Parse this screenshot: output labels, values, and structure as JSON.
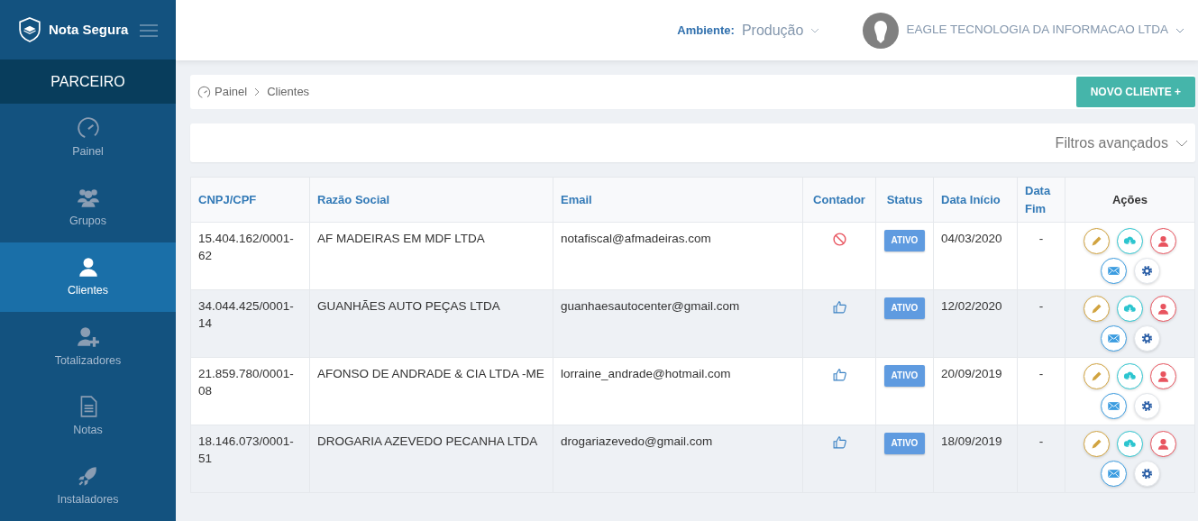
{
  "brand": "Nota Segura",
  "sidebar": {
    "section": "PARCEIRO",
    "items": [
      {
        "label": "Painel",
        "selected": false
      },
      {
        "label": "Grupos",
        "selected": false
      },
      {
        "label": "Clientes",
        "selected": true
      },
      {
        "label": "Totalizadores",
        "selected": false
      },
      {
        "label": "Notas",
        "selected": false
      },
      {
        "label": "Instaladores",
        "selected": false
      }
    ]
  },
  "topbar": {
    "env_label": "Ambiente:",
    "env_value": "Produção",
    "company": "EAGLE TECNOLOGIA DA INFORMACAO LTDA"
  },
  "breadcrumb": [
    "Painel",
    "Clientes"
  ],
  "new_button": "NOVO CLIENTE +",
  "filters": "Filtros avançados",
  "table": {
    "columns": [
      "CNPJ/CPF",
      "Razão Social",
      "Email",
      "Contador",
      "Status",
      "Data Início",
      "Data Fim",
      "Ações"
    ],
    "rows": [
      {
        "cnpj": "15.404.162/0001-62",
        "name": "AF MADEIRAS EM MDF LTDA",
        "email": "notafiscal@afmadeiras.com",
        "contador_approved": false,
        "status": "ATIVO",
        "start": "04/03/2020",
        "end": "-"
      },
      {
        "cnpj": "34.044.425/0001-14",
        "name": "GUANHÃES AUTO PEÇAS LTDA",
        "email": "guanhaesautocenter@gmail.com",
        "contador_approved": true,
        "status": "ATIVO",
        "start": "12/02/2020",
        "end": "-"
      },
      {
        "cnpj": "21.859.780/0001-08",
        "name": "AFONSO DE ANDRADE & CIA LTDA -ME",
        "email": "lorraine_andrade@hotmail.com",
        "contador_approved": true,
        "status": "ATIVO",
        "start": "20/09/2019",
        "end": "-"
      },
      {
        "cnpj": "18.146.073/0001-51",
        "name": "DROGARIA AZEVEDO PECANHA LTDA",
        "email": "drogariazevedo@gmail.com",
        "contador_approved": true,
        "status": "ATIVO",
        "start": "18/09/2019",
        "end": "-"
      }
    ]
  }
}
